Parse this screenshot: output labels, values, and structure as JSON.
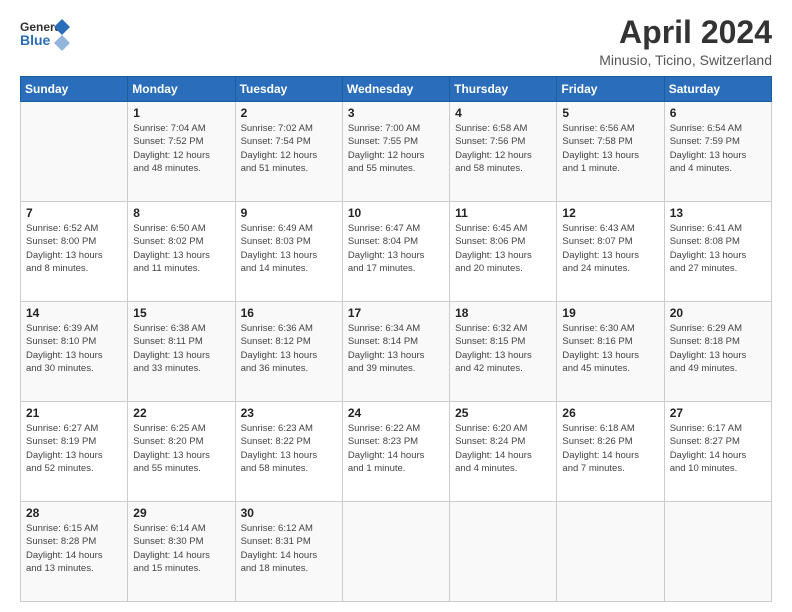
{
  "logo": {
    "line1": "General",
    "line2": "Blue"
  },
  "title": "April 2024",
  "subtitle": "Minusio, Ticino, Switzerland",
  "days_header": [
    "Sunday",
    "Monday",
    "Tuesday",
    "Wednesday",
    "Thursday",
    "Friday",
    "Saturday"
  ],
  "weeks": [
    [
      {
        "day": "",
        "info": ""
      },
      {
        "day": "1",
        "info": "Sunrise: 7:04 AM\nSunset: 7:52 PM\nDaylight: 12 hours\nand 48 minutes."
      },
      {
        "day": "2",
        "info": "Sunrise: 7:02 AM\nSunset: 7:54 PM\nDaylight: 12 hours\nand 51 minutes."
      },
      {
        "day": "3",
        "info": "Sunrise: 7:00 AM\nSunset: 7:55 PM\nDaylight: 12 hours\nand 55 minutes."
      },
      {
        "day": "4",
        "info": "Sunrise: 6:58 AM\nSunset: 7:56 PM\nDaylight: 12 hours\nand 58 minutes."
      },
      {
        "day": "5",
        "info": "Sunrise: 6:56 AM\nSunset: 7:58 PM\nDaylight: 13 hours\nand 1 minute."
      },
      {
        "day": "6",
        "info": "Sunrise: 6:54 AM\nSunset: 7:59 PM\nDaylight: 13 hours\nand 4 minutes."
      }
    ],
    [
      {
        "day": "7",
        "info": "Sunrise: 6:52 AM\nSunset: 8:00 PM\nDaylight: 13 hours\nand 8 minutes."
      },
      {
        "day": "8",
        "info": "Sunrise: 6:50 AM\nSunset: 8:02 PM\nDaylight: 13 hours\nand 11 minutes."
      },
      {
        "day": "9",
        "info": "Sunrise: 6:49 AM\nSunset: 8:03 PM\nDaylight: 13 hours\nand 14 minutes."
      },
      {
        "day": "10",
        "info": "Sunrise: 6:47 AM\nSunset: 8:04 PM\nDaylight: 13 hours\nand 17 minutes."
      },
      {
        "day": "11",
        "info": "Sunrise: 6:45 AM\nSunset: 8:06 PM\nDaylight: 13 hours\nand 20 minutes."
      },
      {
        "day": "12",
        "info": "Sunrise: 6:43 AM\nSunset: 8:07 PM\nDaylight: 13 hours\nand 24 minutes."
      },
      {
        "day": "13",
        "info": "Sunrise: 6:41 AM\nSunset: 8:08 PM\nDaylight: 13 hours\nand 27 minutes."
      }
    ],
    [
      {
        "day": "14",
        "info": "Sunrise: 6:39 AM\nSunset: 8:10 PM\nDaylight: 13 hours\nand 30 minutes."
      },
      {
        "day": "15",
        "info": "Sunrise: 6:38 AM\nSunset: 8:11 PM\nDaylight: 13 hours\nand 33 minutes."
      },
      {
        "day": "16",
        "info": "Sunrise: 6:36 AM\nSunset: 8:12 PM\nDaylight: 13 hours\nand 36 minutes."
      },
      {
        "day": "17",
        "info": "Sunrise: 6:34 AM\nSunset: 8:14 PM\nDaylight: 13 hours\nand 39 minutes."
      },
      {
        "day": "18",
        "info": "Sunrise: 6:32 AM\nSunset: 8:15 PM\nDaylight: 13 hours\nand 42 minutes."
      },
      {
        "day": "19",
        "info": "Sunrise: 6:30 AM\nSunset: 8:16 PM\nDaylight: 13 hours\nand 45 minutes."
      },
      {
        "day": "20",
        "info": "Sunrise: 6:29 AM\nSunset: 8:18 PM\nDaylight: 13 hours\nand 49 minutes."
      }
    ],
    [
      {
        "day": "21",
        "info": "Sunrise: 6:27 AM\nSunset: 8:19 PM\nDaylight: 13 hours\nand 52 minutes."
      },
      {
        "day": "22",
        "info": "Sunrise: 6:25 AM\nSunset: 8:20 PM\nDaylight: 13 hours\nand 55 minutes."
      },
      {
        "day": "23",
        "info": "Sunrise: 6:23 AM\nSunset: 8:22 PM\nDaylight: 13 hours\nand 58 minutes."
      },
      {
        "day": "24",
        "info": "Sunrise: 6:22 AM\nSunset: 8:23 PM\nDaylight: 14 hours\nand 1 minute."
      },
      {
        "day": "25",
        "info": "Sunrise: 6:20 AM\nSunset: 8:24 PM\nDaylight: 14 hours\nand 4 minutes."
      },
      {
        "day": "26",
        "info": "Sunrise: 6:18 AM\nSunset: 8:26 PM\nDaylight: 14 hours\nand 7 minutes."
      },
      {
        "day": "27",
        "info": "Sunrise: 6:17 AM\nSunset: 8:27 PM\nDaylight: 14 hours\nand 10 minutes."
      }
    ],
    [
      {
        "day": "28",
        "info": "Sunrise: 6:15 AM\nSunset: 8:28 PM\nDaylight: 14 hours\nand 13 minutes."
      },
      {
        "day": "29",
        "info": "Sunrise: 6:14 AM\nSunset: 8:30 PM\nDaylight: 14 hours\nand 15 minutes."
      },
      {
        "day": "30",
        "info": "Sunrise: 6:12 AM\nSunset: 8:31 PM\nDaylight: 14 hours\nand 18 minutes."
      },
      {
        "day": "",
        "info": ""
      },
      {
        "day": "",
        "info": ""
      },
      {
        "day": "",
        "info": ""
      },
      {
        "day": "",
        "info": ""
      }
    ]
  ]
}
